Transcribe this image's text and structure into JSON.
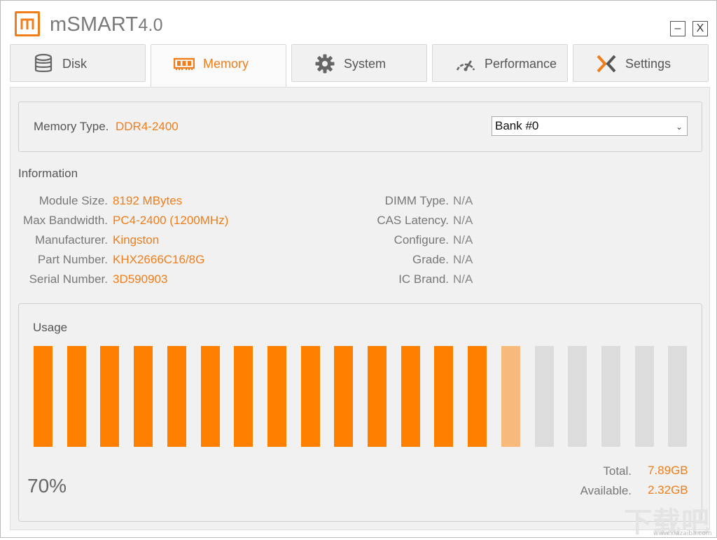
{
  "app": {
    "title": "mSMART",
    "version": "4.0",
    "minimize_label": "–",
    "close_label": "X"
  },
  "tabs": [
    {
      "label": "Disk",
      "icon": "database-icon"
    },
    {
      "label": "Memory",
      "icon": "memory-chip-icon",
      "active": true
    },
    {
      "label": "System",
      "icon": "gear-icon"
    },
    {
      "label": "Performance",
      "icon": "speedometer-icon"
    },
    {
      "label": "Settings",
      "icon": "x-cross-icon"
    }
  ],
  "memory": {
    "type_label": "Memory Type.",
    "type_value": "DDR4-2400",
    "bank_selected": "Bank #0"
  },
  "information": {
    "title": "Information",
    "left": [
      {
        "label": "Module Size.",
        "value": "8192 MBytes"
      },
      {
        "label": "Max Bandwidth.",
        "value": "PC4-2400 (1200MHz)"
      },
      {
        "label": "Manufacturer.",
        "value": "Kingston"
      },
      {
        "label": "Part Number.",
        "value": "KHX2666C16/8G"
      },
      {
        "label": "Serial Number.",
        "value": "3D590903"
      }
    ],
    "right": [
      {
        "label": "DIMM Type.",
        "value": "N/A"
      },
      {
        "label": "CAS Latency.",
        "value": "N/A"
      },
      {
        "label": "Configure.",
        "value": "N/A"
      },
      {
        "label": "Grade.",
        "value": "N/A"
      },
      {
        "label": "IC Brand.",
        "value": "N/A"
      }
    ]
  },
  "usage": {
    "title": "Usage",
    "percent": 70,
    "percent_label": "70%",
    "bar_count": 20,
    "total_label": "Total.",
    "total_value": "7.89GB",
    "available_label": "Available.",
    "available_value": "2.32GB"
  },
  "colors": {
    "accent": "#f07d1a",
    "bar_filled": "#ff8000",
    "bar_partial": "#f7b97c",
    "bar_empty": "#dcdcdc"
  },
  "watermark": {
    "text": "下载吧",
    "url_text": "www.xiazaiba.com"
  }
}
